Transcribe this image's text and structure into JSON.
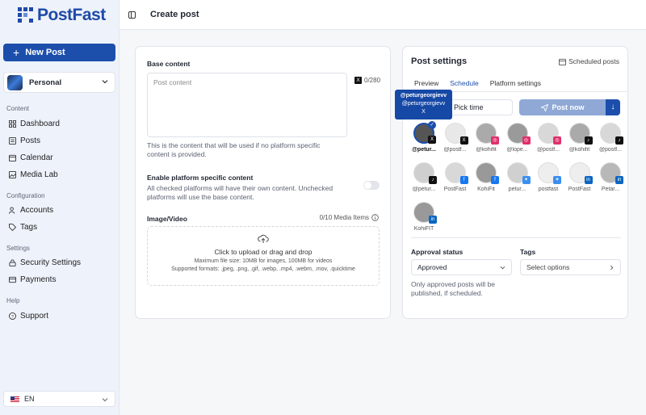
{
  "app": {
    "name": "PostFast"
  },
  "sidebar": {
    "new_post": "New Post",
    "workspace": "Personal",
    "sections": {
      "content": "Content",
      "configuration": "Configuration",
      "settings": "Settings",
      "help": "Help"
    },
    "items": [
      {
        "label": "Dashboard",
        "icon": "dashboard-icon"
      },
      {
        "label": "Posts",
        "icon": "posts-icon"
      },
      {
        "label": "Calendar",
        "icon": "calendar-icon"
      },
      {
        "label": "Media Lab",
        "icon": "image-icon"
      },
      {
        "label": "Accounts",
        "icon": "users-icon"
      },
      {
        "label": "Tags",
        "icon": "tag-icon"
      },
      {
        "label": "Security Settings",
        "icon": "lock-icon"
      },
      {
        "label": "Payments",
        "icon": "card-icon"
      },
      {
        "label": "Support",
        "icon": "help-circle-icon"
      }
    ],
    "language": "EN"
  },
  "header": {
    "title": "Create post"
  },
  "editor": {
    "base_content_label": "Base content",
    "content_placeholder": "Post content",
    "char_count": "0/280",
    "platform_badge": "X",
    "base_help": "This is the content that will be used if no platform specific content is provided.",
    "platform_specific_label": "Enable platform specific content",
    "platform_specific_help": "All checked platforms will have their own content. Unchecked platforms will use the base content.",
    "platform_specific_enabled": false,
    "media_label": "Image/Video",
    "media_count": "0/10 Media Items",
    "upload_text": "Click to upload or drag and drop",
    "upload_size": "Maximum file size: 10MB for images, 100MB for videos",
    "upload_formats": "Supported formats: .jpeg, .png, .gif, .webp, .mp4, .webm, .mov, .quicktime"
  },
  "post_settings": {
    "title": "Post settings",
    "scheduled_posts": "Scheduled posts",
    "tabs": [
      "Preview",
      "Schedule",
      "Platform settings"
    ],
    "active_tab": "Schedule",
    "pick_time": "Pick time",
    "post_now": "Post now",
    "tooltip": {
      "handle": "@peturgeorgievv",
      "subhandle": "@peturgeorgievv",
      "platform": "X"
    },
    "accounts": [
      {
        "name": "@petur...",
        "platform": "x",
        "selected": true
      },
      {
        "name": "@postf...",
        "platform": "x",
        "selected": false
      },
      {
        "name": "@kohifit",
        "platform": "instagram",
        "selected": false
      },
      {
        "name": "@lope...",
        "platform": "instagram",
        "selected": false
      },
      {
        "name": "@postf...",
        "platform": "instagram",
        "selected": false
      },
      {
        "name": "@kohifit",
        "platform": "tiktok",
        "selected": false
      },
      {
        "name": "@postf...",
        "platform": "tiktok",
        "selected": false
      },
      {
        "name": "@petur...",
        "platform": "tiktok",
        "selected": false
      },
      {
        "name": "PostFast",
        "platform": "facebook",
        "selected": false
      },
      {
        "name": "KohiFit",
        "platform": "facebook",
        "selected": false
      },
      {
        "name": "petur...",
        "platform": "bluesky",
        "selected": false
      },
      {
        "name": "postfast",
        "platform": "bluesky",
        "selected": false
      },
      {
        "name": "PostFast",
        "platform": "linkedin",
        "selected": false
      },
      {
        "name": "Petar...",
        "platform": "linkedin",
        "selected": false
      },
      {
        "name": "KohiFIT",
        "platform": "linkedin",
        "selected": false
      }
    ],
    "approval_label": "Approval status",
    "approval_value": "Approved",
    "approval_help": "Only approved posts will be published, if scheduled.",
    "tags_label": "Tags",
    "tags_placeholder": "Select options"
  },
  "colors": {
    "primary": "#1c4fab",
    "x": "#111111",
    "instagram": "#e1306c",
    "tiktok": "#111111",
    "facebook": "#1877f2",
    "bluesky": "#3b8ff0",
    "linkedin": "#0a66c2"
  }
}
